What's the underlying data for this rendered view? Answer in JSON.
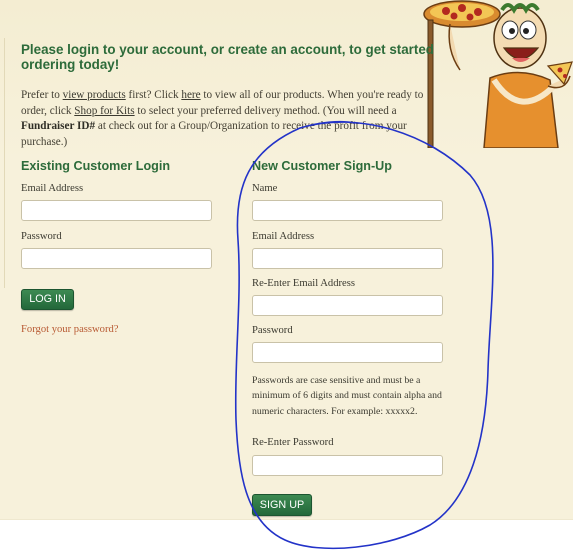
{
  "page": {
    "title": "Please login to your account, or create an account, to get started ordering today!",
    "intro": {
      "t1": "Prefer to ",
      "link_view_products": "view products",
      "t2": " first? Click ",
      "link_here": "here",
      "t3": " to view all of our products. When you're ready to order, click ",
      "link_shop_for_kits": "Shop for Kits",
      "t4": " to select your preferred delivery method. (You will need a ",
      "emph": "Fundraiser ID#",
      "t5": " at check out for a Group/Organization to receive the profit from your purchase.)"
    }
  },
  "login": {
    "heading": "Existing Customer Login",
    "email_label": "Email Address",
    "email_value": "",
    "password_label": "Password",
    "password_value": "",
    "button_label": "LOG IN",
    "forgot_link": "Forgot your password?"
  },
  "signup": {
    "heading": "New Customer Sign-Up",
    "name_label": "Name",
    "name_value": "",
    "email_label": "Email Address",
    "email_value": "",
    "reenter_email_label": "Re-Enter Email Address",
    "reenter_email_value": "",
    "password_label": "Password",
    "password_value": "",
    "password_help": "Passwords are case sensitive and must be a minimum of 6 digits and must contain alpha and numeric characters. For example: xxxxx2.",
    "reenter_password_label": "Re-Enter Password",
    "reenter_password_value": "",
    "button_label": "SIGN UP"
  },
  "icons": {
    "mascot": "pizza-chef-mascot-icon"
  },
  "colors": {
    "background": "#f7f1db",
    "heading_green": "#2d6b3a",
    "button_green": "#23683a",
    "link_orange": "#b85a33",
    "annotation_blue": "#2333c8"
  }
}
